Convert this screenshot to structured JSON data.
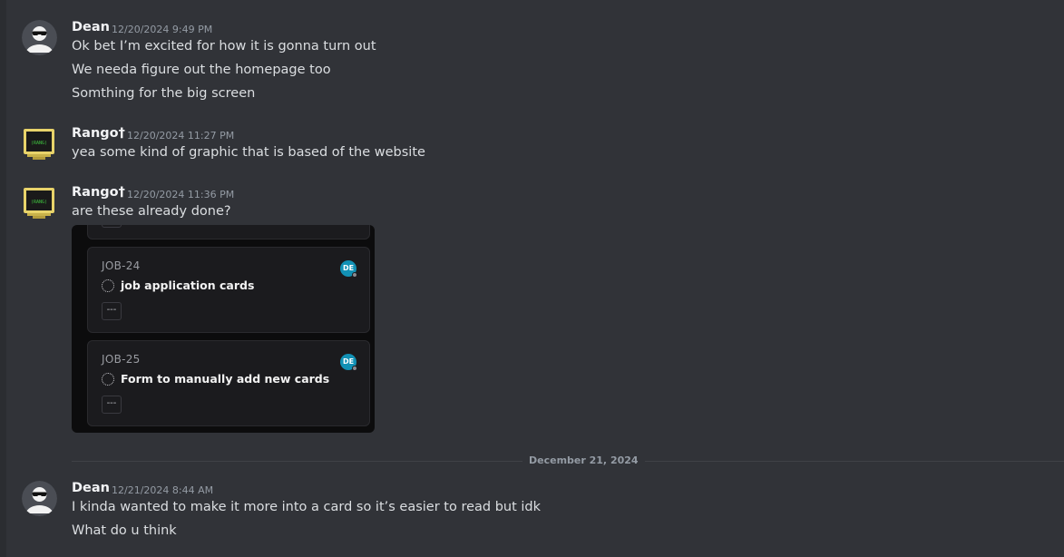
{
  "messages": [
    {
      "author": "Dean",
      "time": "12/20/2024 9:49 PM",
      "lines": [
        "Ok bet I’m excited for how it is gonna turn out",
        "We needa figure out the homepage too",
        "Somthing for the big screen"
      ]
    },
    {
      "author": "Rango†",
      "time": "12/20/2024 11:27 PM",
      "lines": [
        "yea some kind of graphic that is based of the website"
      ]
    },
    {
      "author": "Rango†",
      "time": "12/20/2024 11:36 PM",
      "lines": [
        "are these already done?"
      ],
      "attachment": {
        "cards": [
          {
            "id": "JOB-24",
            "title": "job application cards",
            "assignee": "DE",
            "more": "---"
          },
          {
            "id": "JOB-25",
            "title": "Form to manually add new cards",
            "assignee": "DE",
            "more": "---"
          }
        ]
      }
    }
  ],
  "date_divider": "December 21, 2024",
  "messages_after": [
    {
      "author": "Dean",
      "time": "12/21/2024 8:44 AM",
      "lines": [
        "I kinda wanted to make it more into a card so it’s easier to read but idk",
        "What do u think"
      ]
    }
  ],
  "colors": {
    "background": "#313338",
    "assignee_badge": "#1291b5",
    "rango_avatar_frame": "#e8d36a"
  }
}
